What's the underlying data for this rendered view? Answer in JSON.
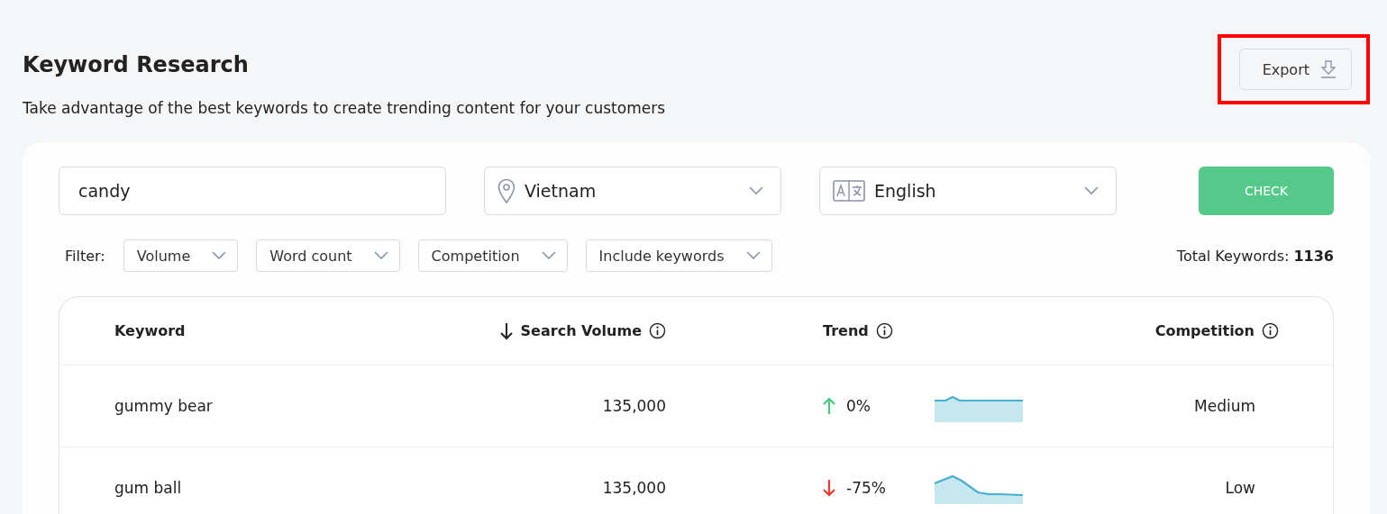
{
  "header": {
    "title": "Keyword Research",
    "subtitle": "Take advantage of the best keywords to create trending content for your customers",
    "export_button": "Export",
    "export_highlighted": true
  },
  "search": {
    "keyword": "candy",
    "location": "Vietnam",
    "language": "English",
    "check_button": "CHECK"
  },
  "filters": {
    "label": "Filter:",
    "dropdowns": [
      "Volume",
      "Word count",
      "Competition",
      "Include keywords"
    ],
    "total_label": "Total Keywords: ",
    "total_value": "1136"
  },
  "table": {
    "columns": [
      "Keyword",
      "Search Volume",
      "Trend",
      "Competition"
    ],
    "rows": [
      {
        "keyword": "gummy bear",
        "volume": "135,000",
        "trend": {
          "kind": "up",
          "change": "0%"
        },
        "competition": "Medium"
      },
      {
        "keyword": "gum ball",
        "volume": "135,000",
        "trend": {
          "kind": "down",
          "change": "-75%"
        },
        "competition": "Low"
      }
    ]
  }
}
